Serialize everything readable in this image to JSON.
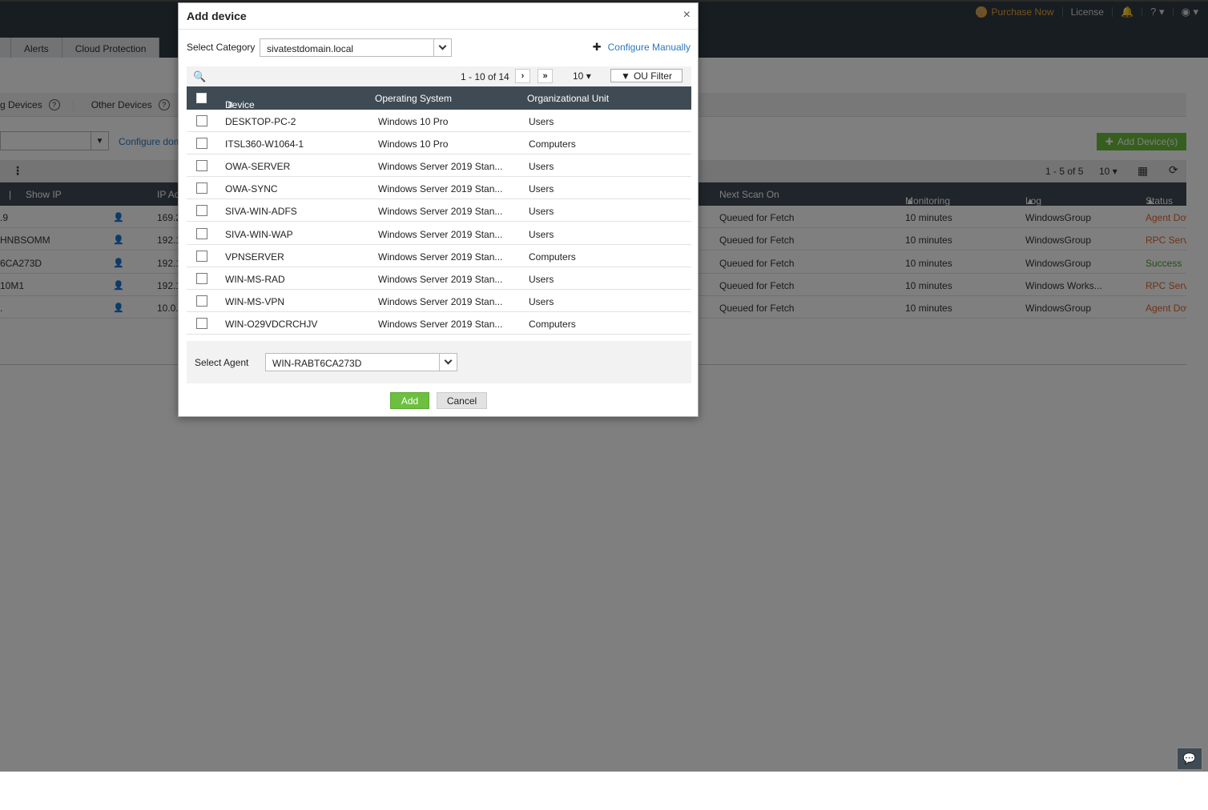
{
  "topbar": {
    "purchase_label": "Purchase Now",
    "license_label": "License",
    "help_symbol": "?",
    "icons": [
      "cart-icon",
      "bell-icon",
      "help-icon",
      "user-icon"
    ]
  },
  "nav_tabs": [
    "Alerts",
    "Cloud Protection"
  ],
  "device_tabs": {
    "windows_partial": "g Devices",
    "other": "Other Devices",
    "help_symbol": "?"
  },
  "background": {
    "configure_link": "Configure doma",
    "add_devices_label": "Add Device(s)",
    "pager_text": "1 - 5 of 5",
    "per_page": "10",
    "columns": {
      "show_ip": "Show IP",
      "ip": "IP Ad",
      "next_scan": "Next Scan On",
      "interval": "Monitoring Interval",
      "log_source": "Log Source Group",
      "status": "Status"
    },
    "rows": [
      {
        "name": ".9",
        "ip": "169.2",
        "next_scan": "Queued for Fetch",
        "interval": "10 minutes",
        "group": "WindowsGroup",
        "status": "Agent Dow",
        "status_kind": "red"
      },
      {
        "name": "HNBSOMM",
        "ip": "192.1",
        "next_scan": "Queued for Fetch",
        "interval": "10 minutes",
        "group": "WindowsGroup",
        "status": "RPC Serve",
        "status_kind": "red"
      },
      {
        "name": "6CA273D",
        "ip": "192.1",
        "next_scan": "Queued for Fetch",
        "interval": "10 minutes",
        "group": "WindowsGroup",
        "status": "Success",
        "status_kind": "green"
      },
      {
        "name": "10M1",
        "ip": "192.1",
        "next_scan": "Queued for Fetch",
        "interval": "10 minutes",
        "group": "Windows Works...",
        "status": "RPC Serve",
        "status_kind": "red"
      },
      {
        "name": ".",
        "ip": "10.0.",
        "next_scan": "Queued for Fetch",
        "interval": "10 minutes",
        "group": "WindowsGroup",
        "status": "Agent Dow",
        "status_kind": "red"
      }
    ]
  },
  "modal": {
    "title": "Add device",
    "close_symbol": "×",
    "category_label": "Select Category",
    "category_value": "sivatestdomain.local",
    "configure_manually": "Configure Manually",
    "pager_text": "1 - 10 of 14",
    "per_page": "10",
    "ou_filter": "OU Filter",
    "columns": {
      "device": "Device",
      "os": "Operating System",
      "ou": "Organizational Unit"
    },
    "rows": [
      {
        "device": "DESKTOP-PC-2",
        "os": "Windows 10 Pro",
        "ou": "Users"
      },
      {
        "device": "ITSL360-W1064-1",
        "os": "Windows 10 Pro",
        "ou": "Computers"
      },
      {
        "device": "OWA-SERVER",
        "os": "Windows Server 2019 Stan...",
        "ou": "Users"
      },
      {
        "device": "OWA-SYNC",
        "os": "Windows Server 2019 Stan...",
        "ou": "Users"
      },
      {
        "device": "SIVA-WIN-ADFS",
        "os": "Windows Server 2019 Stan...",
        "ou": "Users"
      },
      {
        "device": "SIVA-WIN-WAP",
        "os": "Windows Server 2019 Stan...",
        "ou": "Users"
      },
      {
        "device": "VPNSERVER",
        "os": "Windows Server 2019 Stan...",
        "ou": "Computers"
      },
      {
        "device": "WIN-MS-RAD",
        "os": "Windows Server 2019 Stan...",
        "ou": "Users"
      },
      {
        "device": "WIN-MS-VPN",
        "os": "Windows Server 2019 Stan...",
        "ou": "Users"
      },
      {
        "device": "WIN-O29VDCRCHJV",
        "os": "Windows Server 2019 Stan...",
        "ou": "Computers"
      }
    ],
    "agent_label": "Select Agent",
    "agent_value": "WIN-RABT6CA273D",
    "add_label": "Add",
    "cancel_label": "Cancel"
  },
  "colors": {
    "accent_green": "#6cbf3f",
    "link_blue": "#2a78c0",
    "header_dark": "#3e4b54",
    "status_red": "#e0672d",
    "status_green": "#4a9a2b"
  }
}
